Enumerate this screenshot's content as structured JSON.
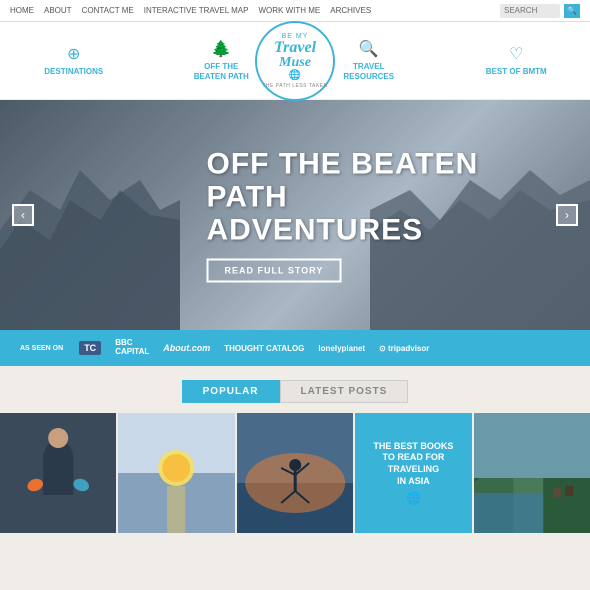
{
  "topnav": {
    "links": [
      "HOME",
      "ABOUT",
      "CONTACT ME",
      "INTERACTIVE TRAVEL MAP",
      "WORK WITH ME",
      "ARCHIVES"
    ],
    "search_placeholder": "SEARCH"
  },
  "mainnav": {
    "items": [
      {
        "id": "destinations",
        "label": "DESTINATIONS",
        "icon": "⊕"
      },
      {
        "id": "offbeaten",
        "label": "OFF THE\nBEATEN PATH",
        "icon": "🌲"
      },
      {
        "id": "resources",
        "label": "TRAVEL\nRESOURCES",
        "icon": "🔍"
      },
      {
        "id": "bestof",
        "label": "BEST OF BMTM",
        "icon": "♡"
      }
    ]
  },
  "logo": {
    "be_my": "BE MY",
    "travel": "Travel",
    "muse": "Muse",
    "subtitle": "THE PATH LESS TAKEN"
  },
  "hero": {
    "title_line1": "OFF THE BEATEN",
    "title_line2": "PATH ADVENTURES",
    "read_btn": "READ FULL STORY",
    "arrow_left": "‹",
    "arrow_right": "›"
  },
  "as_seen_on": {
    "label": "AS SEEN ON",
    "logos": [
      {
        "id": "tc",
        "text": "TC"
      },
      {
        "id": "bbc",
        "text": "BBC\nCAPITAL"
      },
      {
        "id": "about",
        "text": "About.com"
      },
      {
        "id": "thought",
        "text": "THOUGHT CATALOG"
      },
      {
        "id": "lonely",
        "text": "lonelyplanet"
      },
      {
        "id": "trip",
        "text": "⊙ tripadvisor"
      }
    ]
  },
  "tabs": {
    "popular": "POPULAR",
    "latest": "LATEST POSTS"
  },
  "thumbs": [
    {
      "id": "thumb-1",
      "alt": "Woman with colorful mittens"
    },
    {
      "id": "thumb-2",
      "alt": "Sunset over water"
    },
    {
      "id": "thumb-3",
      "alt": "Person doing yoga at sunset"
    },
    {
      "id": "thumb-4",
      "title": "THE BEST BOOKS\nTO READ FOR\nTRAVELING\nIN ASIA",
      "has_icon": true
    },
    {
      "id": "thumb-5",
      "alt": "Coastal cliffs with horses"
    }
  ]
}
